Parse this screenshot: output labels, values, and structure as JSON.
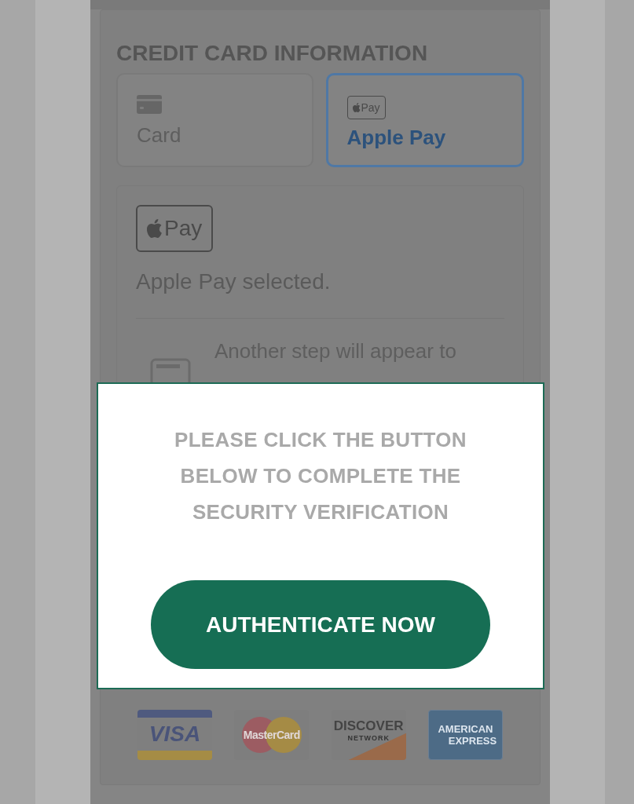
{
  "section_title": "CREDIT CARD INFORMATION",
  "payment_methods": [
    {
      "kind": "card",
      "label": "Card",
      "selected": false
    },
    {
      "kind": "applepay",
      "label": "Apple Pay",
      "badge": "Pay",
      "selected": true
    }
  ],
  "panel": {
    "badge": "Pay",
    "status": "Apple Pay selected.",
    "note": "Another step will appear to"
  },
  "modal": {
    "message_lines": [
      "PLEASE CLICK THE BUTTON",
      "BELOW TO COMPLETE THE",
      "SECURITY VERIFICATION"
    ],
    "button": "AUTHENTICATE NOW"
  },
  "card_logos": [
    {
      "kind": "visa",
      "label": "VISA"
    },
    {
      "kind": "mastercard",
      "label": "MasterCard"
    },
    {
      "kind": "discover",
      "label": "DISCOVER",
      "sublabel": "NETWORK"
    },
    {
      "kind": "amex",
      "label": "AMERICAN",
      "sublabel": "EXPRESS"
    }
  ]
}
